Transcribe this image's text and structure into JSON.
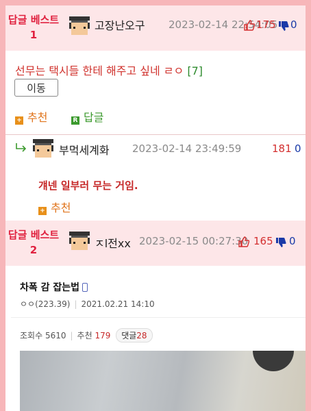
{
  "best1": {
    "label": "답글 베스트1",
    "nick": "고장난오구",
    "date": "2023-02-14 22:54:05",
    "up": "175",
    "down": "0"
  },
  "post": {
    "title": "선무는 택시들 한테 해주고 싶네 ㄹㅇ",
    "comment_count": "[7]",
    "move_label": "이동",
    "recommend_label": "추천",
    "reply_label": "답글",
    "reply_icon_letter": "R"
  },
  "reply": {
    "nick": "부먹세계화",
    "date": "2023-02-14 23:49:59",
    "up": "181",
    "down": "0",
    "text": "걔넨 일부러 무는 거임.",
    "recommend_label": "추천"
  },
  "best2": {
    "label": "답글 베스트2",
    "nick": "ㅈl전xx",
    "date": "2023-02-15 00:27:30",
    "up": "165",
    "down": "0"
  },
  "article": {
    "title": "차폭 감 잡는법",
    "author": "ㅇㅇ(223.39)",
    "date": "2021.02.21 14:10",
    "views_label": "조회수",
    "views": "5610",
    "recommend_label": "추천",
    "recommend": "179",
    "comments_label": "댓글",
    "comments": "28"
  },
  "colors": {
    "accent": "#e0213f",
    "best_bg": "#fde6e8",
    "frame_bg": "#f7b6b9"
  }
}
